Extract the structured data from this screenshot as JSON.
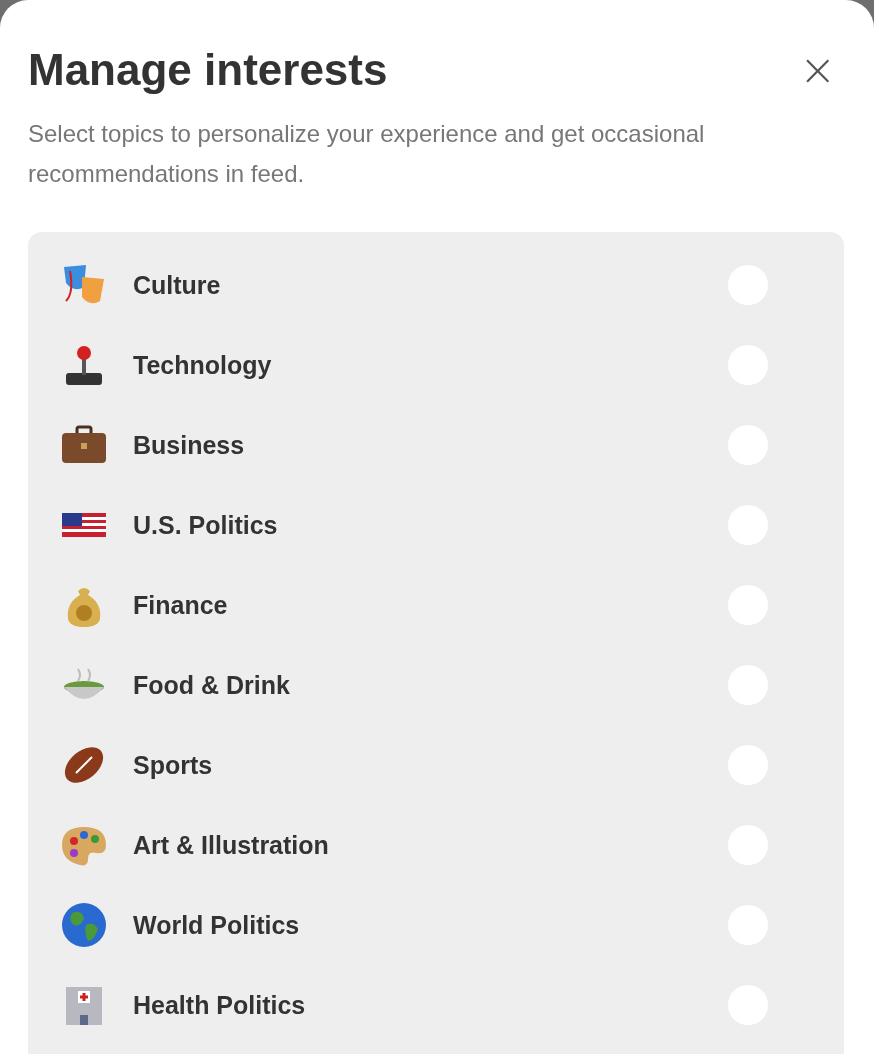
{
  "dialog": {
    "title": "Manage interests",
    "close": "×",
    "description": "Select topics to personalize your experience and get occasional recommendations in feed."
  },
  "topics": [
    {
      "label": "Culture",
      "selected": false
    },
    {
      "label": "Technology",
      "selected": false
    },
    {
      "label": "Business",
      "selected": false
    },
    {
      "label": "U.S. Politics",
      "selected": false
    },
    {
      "label": "Finance",
      "selected": false
    },
    {
      "label": "Food & Drink",
      "selected": false
    },
    {
      "label": "Sports",
      "selected": false
    },
    {
      "label": "Art & Illustration",
      "selected": false
    },
    {
      "label": "World Politics",
      "selected": false
    },
    {
      "label": "Health Politics",
      "selected": false
    }
  ]
}
